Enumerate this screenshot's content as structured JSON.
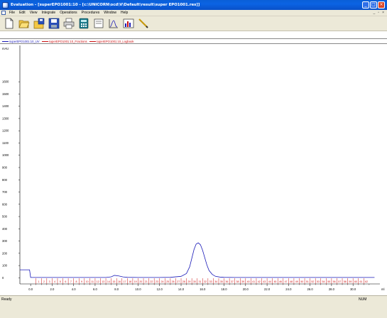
{
  "window": {
    "title": "Evaluation - [superEPO1001:10 - [c:\\UNICORN\\ocd\\V\\Default\\result\\super EPO1001.res]]"
  },
  "menu": {
    "items": [
      "File",
      "Edit",
      "View",
      "Integrate",
      "Operations",
      "Procedures",
      "Window",
      "Help"
    ]
  },
  "toolbar": {
    "icons": [
      "new-icon",
      "open-icon",
      "save-icon",
      "save-disk-icon",
      "print-icon",
      "calculator-icon",
      "report-icon",
      "chart-icon",
      "edit-chart-icon",
      "pencil-icon"
    ]
  },
  "legend": {
    "items": [
      {
        "label": "superEPO1001:10_UV",
        "color": "#1a1ab8"
      },
      {
        "label": "superEPO1001:10_Fractions",
        "color": "#cc1111"
      },
      {
        "label": "superEPO1001:10_Logbook",
        "color": "#cc1111"
      }
    ]
  },
  "chart_data": {
    "type": "line",
    "ylabel": "mAU",
    "xlabel": "ml",
    "ylim": [
      -50,
      1850
    ],
    "xlim": [
      -1,
      32.5
    ],
    "yticks": [
      0,
      100,
      200,
      300,
      400,
      500,
      600,
      700,
      800,
      900,
      1000,
      1100,
      1200,
      1300,
      1400,
      1500,
      1600
    ],
    "xticks": [
      0.0,
      2.0,
      4.0,
      6.0,
      8.0,
      10.0,
      12.0,
      14.0,
      16.0,
      18.0,
      20.0,
      22.0,
      24.0,
      26.0,
      28.0,
      30.0
    ],
    "xtick_labels": [
      "0.0",
      "2.0",
      "4.0",
      "6.0",
      "8.0",
      "10.0",
      "12.0",
      "14.0",
      "16.0",
      "18.0",
      "20.0",
      "22.0",
      "24.0",
      "26.0",
      "28.0",
      "30.0"
    ],
    "series": [
      {
        "name": "superEPO1001:10_UV",
        "x": [
          -1,
          -0.5,
          -0.1,
          0.0,
          0.5,
          2.0,
          4.0,
          6.0,
          7.0,
          7.5,
          7.8,
          8.2,
          8.6,
          9.0,
          10.0,
          12.0,
          13.0,
          14.0,
          14.5,
          14.8,
          15.0,
          15.2,
          15.4,
          15.6,
          15.8,
          16.0,
          16.2,
          16.4,
          16.6,
          16.9,
          17.2,
          17.6,
          18.0,
          19.0,
          22.0,
          26.0,
          30.0,
          32.0
        ],
        "y": [
          65,
          65,
          65,
          3,
          3,
          3,
          3,
          3,
          3,
          8,
          20,
          15,
          7,
          4,
          3,
          3,
          4,
          12,
          35,
          90,
          160,
          230,
          275,
          285,
          270,
          225,
          165,
          105,
          60,
          28,
          12,
          6,
          4,
          3,
          3,
          3,
          3,
          3
        ]
      }
    ],
    "fractions": {
      "name": "superEPO1001:10_Fractions",
      "labels": [
        "1",
        "2",
        "3",
        "4",
        "5",
        "6",
        "7",
        "8",
        "9",
        "10",
        "11",
        "12",
        "13",
        "14",
        "15",
        "16",
        "17",
        "18",
        "19",
        "20",
        "21",
        "22",
        "23",
        "24",
        "25",
        "26",
        "27",
        "28",
        "29",
        "30",
        "31",
        "32",
        "33",
        "34",
        "35",
        "36",
        "37",
        "38",
        "39",
        "40",
        "41",
        "42",
        "43",
        "44",
        "45",
        "46",
        "47",
        "48",
        "49",
        "50",
        "51",
        "52",
        "53",
        "54",
        "55",
        "56",
        "57",
        "58",
        "59",
        "60",
        "61",
        "62"
      ],
      "start": 0.5,
      "width": 0.5
    }
  },
  "status": {
    "left": "Ready",
    "right": "NUM"
  },
  "colors": {
    "uv_line": "#1a1ab8",
    "fraction": "#cc1111",
    "axis": "#000000"
  }
}
